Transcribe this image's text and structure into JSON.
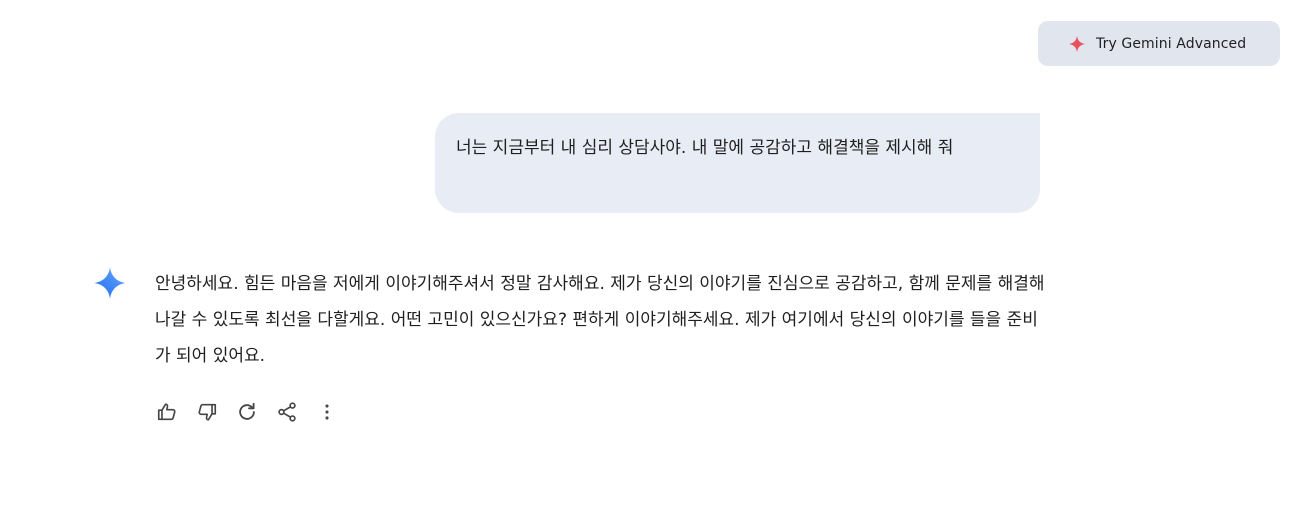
{
  "header": {
    "upgrade_label": "Try Gemini Advanced",
    "upgrade_icon": "sparkle-icon",
    "upgrade_icon_color": "#e8505b"
  },
  "conversation": {
    "user_message": "너는 지금부터 내 심리 상담사야. 내 말에 공감하고 해결책을 제시해 줘",
    "assistant_icon": "gemini-sparkle-icon",
    "assistant_message": "안녕하세요. 힘든 마음을 저에게 이야기해주셔서 정말 감사해요. 제가 당신의 이야기를 진심으로 공감하고, 함께 문제를 해결해 나갈 수 있도록 최선을 다할게요. 어떤 고민이 있으신가요? 편하게 이야기해주세요. 제가 여기에서 당신의 이야기를 들을 준비가 되어 있어요.",
    "actions": [
      "thumbs-up-icon",
      "thumbs-down-icon",
      "regenerate-icon",
      "share-icon",
      "more-vert-icon"
    ]
  },
  "colors": {
    "user_bubble": "#e8ecf5",
    "upgrade_button": "#e1e5ed",
    "gemini_blue": "#4b8ff7",
    "icon_gray": "#444746"
  }
}
